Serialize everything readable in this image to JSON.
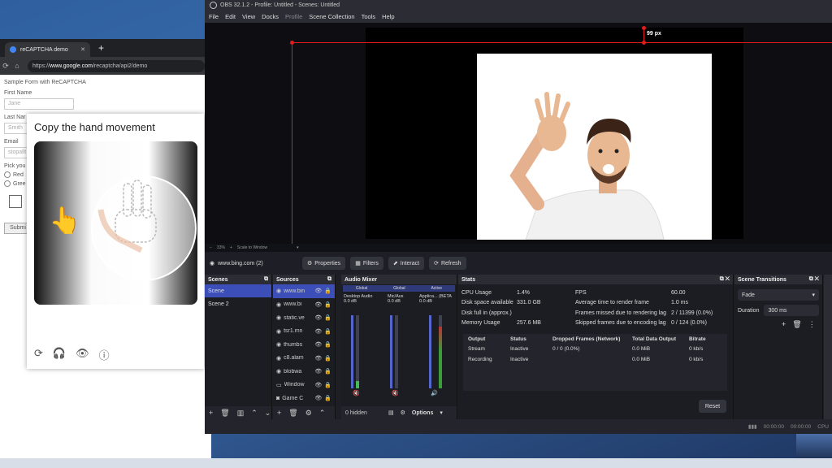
{
  "browser": {
    "tab_title": "reCAPTCHA demo",
    "url_prefix": "https://",
    "url_domain": "www.google.com",
    "url_path": "/recaptcha/api2/demo",
    "form": {
      "heading": "Sample Form with ReCAPTCHA",
      "first_name_label": "First Name",
      "first_name_value": "Jane",
      "last_name_label": "Last Nar",
      "last_name_value": "Smith",
      "email_label": "Email",
      "email_value": "stopallt",
      "pick_label": "Pick you",
      "radio_red": "Red",
      "radio_green": "Gree",
      "submit_label": "Submi"
    },
    "captcha": {
      "title": "Copy the hand movement",
      "finger_emoji": "👆"
    }
  },
  "obs": {
    "window_title": "OBS 32.1.2 - Profile: Untitled - Scenes: Untitled",
    "menu": [
      "File",
      "Edit",
      "View",
      "Docks",
      "Profile",
      "Scene Collection",
      "Tools",
      "Help"
    ],
    "distance_label": "99 px",
    "zoom": {
      "minus": "−",
      "value": "33%",
      "plus": "+",
      "mode": "Scale to Window"
    },
    "source_bar": {
      "source_name": "www.bing.com (2)",
      "properties": "Properties",
      "filters": "Filters",
      "interact": "Interact",
      "refresh": "Refresh"
    },
    "scenes": {
      "title": "Scenes",
      "items": [
        "Scene",
        "Scene 2"
      ]
    },
    "sources": {
      "title": "Sources",
      "items": [
        "www.bin",
        "www.bi",
        "static.ve",
        "tsr1.mn",
        "thumbs",
        "c8.alam",
        "blobwa",
        "Window",
        "Game C"
      ],
      "hidden_label": "0 hidden"
    },
    "mixer": {
      "title": "Audio Mixer",
      "channels": [
        {
          "name": "Desktop Audio",
          "scope": "Global",
          "db": "0.0 dB"
        },
        {
          "name": "Mic/Aux",
          "scope": "Global",
          "db": "0.0 dB"
        },
        {
          "name": "Applica... (BETA",
          "scope": "Active",
          "db": "0.0 dB"
        }
      ],
      "options_label": "Options"
    },
    "stats": {
      "title": "Stats",
      "rows": [
        {
          "label": "CPU Usage",
          "value": "1.4%",
          "label2": "FPS",
          "value2": "60.00"
        },
        {
          "label": "Disk space available",
          "value": "331.0 GB",
          "label2": "Average time to render frame",
          "value2": "1.0 ms"
        },
        {
          "label": "Disk full in (approx.)",
          "value": "",
          "label2": "Frames missed due to rendering lag",
          "value2": "2 / 11399 (0.0%)"
        },
        {
          "label": "Memory Usage",
          "value": "257.6 MB",
          "label2": "Skipped frames due to encoding lag",
          "value2": "0 / 124 (0.0%)"
        }
      ],
      "output_headers": [
        "Output",
        "Status",
        "Dropped Frames (Network)",
        "Total Data Output",
        "Bitrate"
      ],
      "outputs": [
        [
          "Stream",
          "Inactive",
          "0 / 0 (0.0%)",
          "0.0 MiB",
          "0 kb/s"
        ],
        [
          "Recording",
          "Inactive",
          "",
          "0.0 MiB",
          "0 kb/s"
        ]
      ],
      "reset_label": "Reset"
    },
    "transitions": {
      "title": "Scene Transitions",
      "selected": "Fade",
      "duration_label": "Duration",
      "duration_value": "300 ms"
    },
    "status": {
      "time1": "00:00:00",
      "time2": "00:00:00",
      "cpu": "CPU"
    }
  }
}
